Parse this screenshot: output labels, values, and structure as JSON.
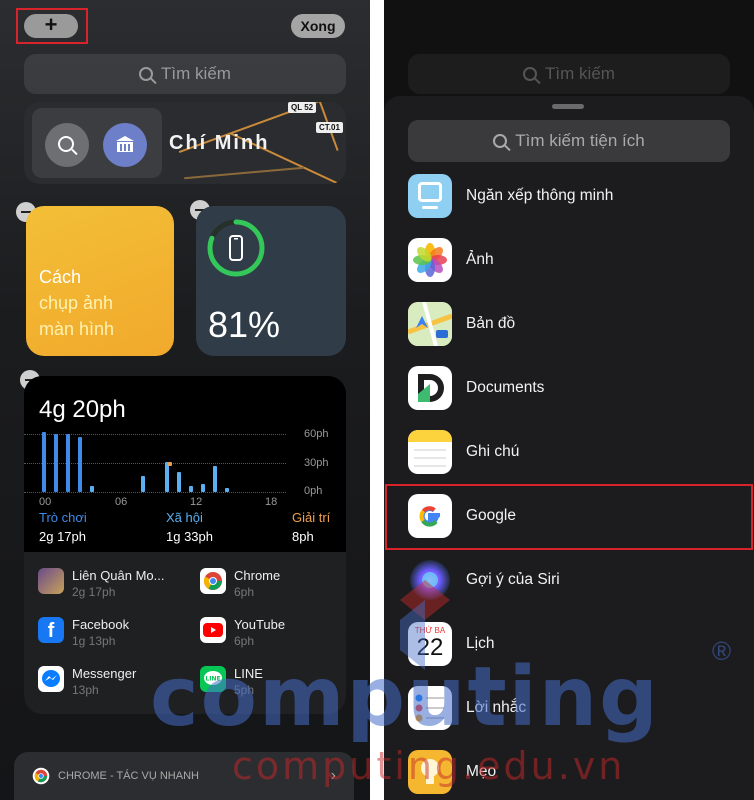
{
  "left": {
    "plus_label": "+",
    "done_label": "Xong",
    "search_placeholder": "Tìm kiếm",
    "map": {
      "city": "Chí Minh",
      "road_tags": [
        "QL 52",
        "CT.01"
      ]
    },
    "tips": {
      "lines": [
        "Cách",
        "chụp ảnh",
        "màn hình"
      ]
    },
    "battery": {
      "percent_label": "81%",
      "level": 0.81,
      "ring_color": "#34c759"
    },
    "screen_time": {
      "total": "4g 20ph",
      "y_ticks": [
        "60ph",
        "30ph",
        "0ph"
      ],
      "x_ticks": [
        "00",
        "06",
        "12",
        "18"
      ],
      "categories": [
        {
          "name": "Trò chơi",
          "time": "2g 17ph",
          "color": "#3e8be8"
        },
        {
          "name": "Xã hội",
          "time": "1g 33ph",
          "color": "#5ab0f0"
        },
        {
          "name": "Giải trí",
          "time": "8ph",
          "color": "#f0a04a"
        }
      ],
      "apps": [
        {
          "name": "Liên Quân Mo...",
          "time": "2g 17ph"
        },
        {
          "name": "Chrome",
          "time": "6ph"
        },
        {
          "name": "Facebook",
          "time": "1g 13ph"
        },
        {
          "name": "YouTube",
          "time": "6ph"
        },
        {
          "name": "Messenger",
          "time": "13ph"
        },
        {
          "name": "LINE",
          "time": "5ph"
        }
      ]
    },
    "chrome_bar": {
      "label": "CHROME - TÁC VỤ NHANH",
      "chevron": "›"
    }
  },
  "right": {
    "search_placeholder_bg": "Tìm kiếm",
    "sheet_search_placeholder": "Tìm kiếm tiện ích",
    "widgets": [
      {
        "label": "Ngăn xếp thông minh",
        "icon": "smart-stack-icon"
      },
      {
        "label": "Ảnh",
        "icon": "photos-icon"
      },
      {
        "label": "Bản đồ",
        "icon": "maps-icon"
      },
      {
        "label": "Documents",
        "icon": "documents-icon"
      },
      {
        "label": "Ghi chú",
        "icon": "notes-icon"
      },
      {
        "label": "Google",
        "icon": "google-icon"
      },
      {
        "label": "Gợi ý của Siri",
        "icon": "siri-icon"
      },
      {
        "label": "Lịch",
        "icon": "calendar-icon",
        "weekday": "THỨ BA",
        "day": "22"
      },
      {
        "label": "Lời nhắc",
        "icon": "reminders-icon"
      },
      {
        "label": "Mẹo",
        "icon": "tips-icon"
      }
    ]
  },
  "watermark": {
    "main": "computing",
    "sub": "computing.edu.vn",
    "reg": "®"
  },
  "colors": {
    "highlight": "#d8232a",
    "accent_blue": "#3e8be8"
  }
}
